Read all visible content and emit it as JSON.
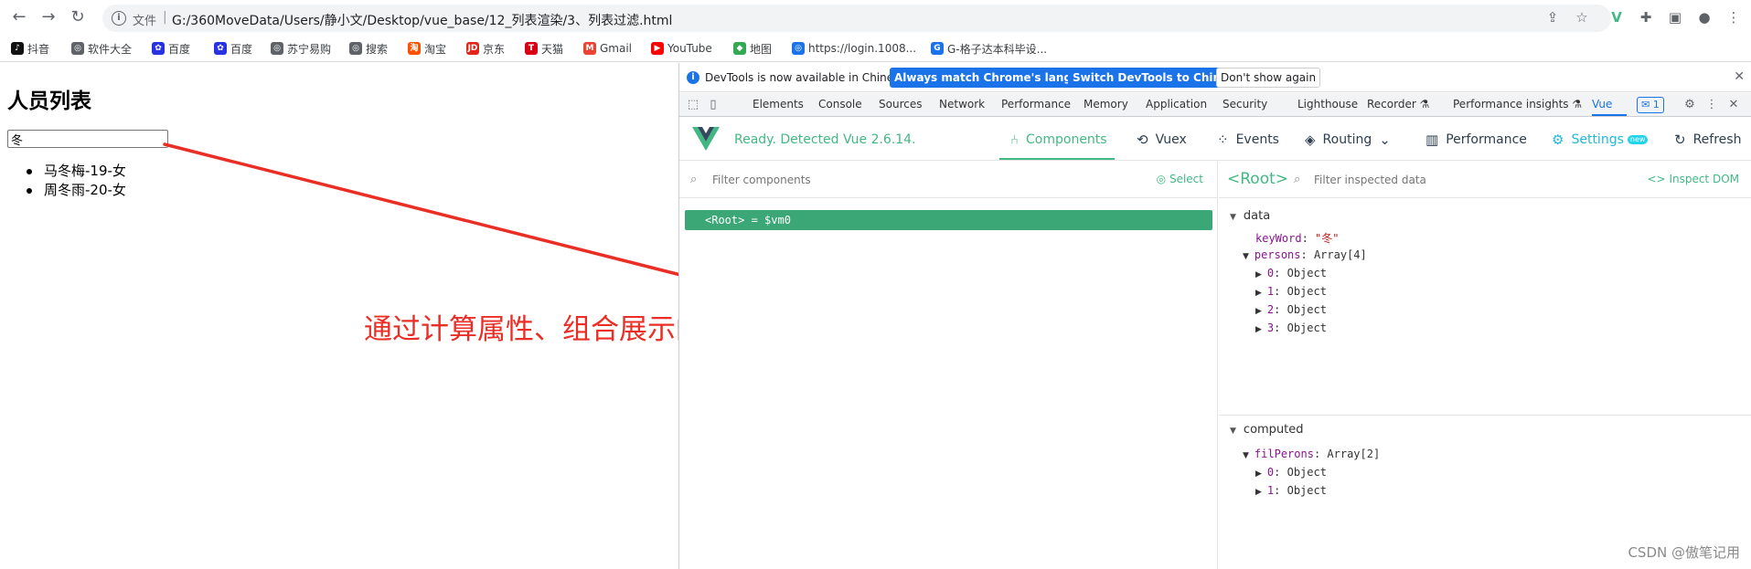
{
  "browser": {
    "back_icon": "arrow-left-icon",
    "forward_icon": "arrow-right-icon",
    "reload_icon": "reload-icon",
    "file_label": "文件",
    "url": "G:/360MoveData/Users/静小文/Desktop/vue_base/12_列表渲染/3、列表过滤.html",
    "bookmarks": [
      {
        "label": "抖音",
        "color": "#111111",
        "glyph": "♪"
      },
      {
        "label": "软件大全",
        "color": "#5f6368",
        "glyph": "◎"
      },
      {
        "label": "百度",
        "color": "#2932e1",
        "glyph": "✿"
      },
      {
        "label": "百度",
        "color": "#2932e1",
        "glyph": "✿"
      },
      {
        "label": "苏宁易购",
        "color": "#5f6368",
        "glyph": "◎"
      },
      {
        "label": "搜索",
        "color": "#5f6368",
        "glyph": "◎"
      },
      {
        "label": "淘宝",
        "color": "#ff5000",
        "glyph": "淘"
      },
      {
        "label": "京东",
        "color": "#e1251b",
        "glyph": "JD"
      },
      {
        "label": "天猫",
        "color": "#d90015",
        "glyph": "T"
      },
      {
        "label": "Gmail",
        "color": "#ea4335",
        "glyph": "M"
      },
      {
        "label": "YouTube",
        "color": "#ff0000",
        "glyph": "▶"
      },
      {
        "label": "地图",
        "color": "#34a853",
        "glyph": "◆"
      },
      {
        "label": "https://login.1008...",
        "color": "#1a73e8",
        "glyph": "◎"
      },
      {
        "label": "G-格子达本科毕设...",
        "color": "#1a73e8",
        "glyph": "G"
      }
    ]
  },
  "page": {
    "title": "人员列表",
    "keyword_value": "冬",
    "persons": [
      "马冬梅-19-女",
      "周冬雨-20-女"
    ]
  },
  "annotation": {
    "text": "通过计算属性、组合展示的数据",
    "color": "#ea2e26"
  },
  "devtools": {
    "info_message": "DevTools is now available in Chinese!",
    "btn_match": "Always match Chrome's language",
    "btn_switch": "Switch DevTools to Chinese",
    "btn_dont_show": "Don't show again",
    "tabs": [
      "Elements",
      "Console",
      "Sources",
      "Network",
      "Performance",
      "Memory",
      "Application",
      "Security",
      "Lighthouse",
      "Recorder ⚗",
      "Performance insights ⚗",
      "Vue"
    ],
    "message_count": "1",
    "vue": {
      "status": "Ready. Detected Vue 2.6.14.",
      "nav": {
        "components": "Components",
        "vuex": "Vuex",
        "events": "Events",
        "routing": "Routing",
        "performance": "Performance",
        "settings": "Settings",
        "settings_badge": "new",
        "refresh": "Refresh"
      },
      "filter_components_placeholder": "Filter components",
      "select_label": "Select",
      "root_node": "<Root> = $vm0",
      "inspector_title": "<Root>",
      "filter_inspected_placeholder": "Filter inspected data",
      "inspect_dom": "Inspect DOM",
      "data_section": "data",
      "keyword_key": "keyWord",
      "keyword_val": "\"冬\"",
      "persons_key": "persons",
      "persons_type": "Array[4]",
      "persons_items": [
        "0",
        "1",
        "2",
        "3"
      ],
      "item_type": "Object",
      "computed_section": "computed",
      "filperons_key": "filPerons",
      "filperons_type": "Array[2]",
      "filperons_items": [
        "0",
        "1"
      ]
    }
  },
  "watermark": "CSDN @傲笔记用"
}
